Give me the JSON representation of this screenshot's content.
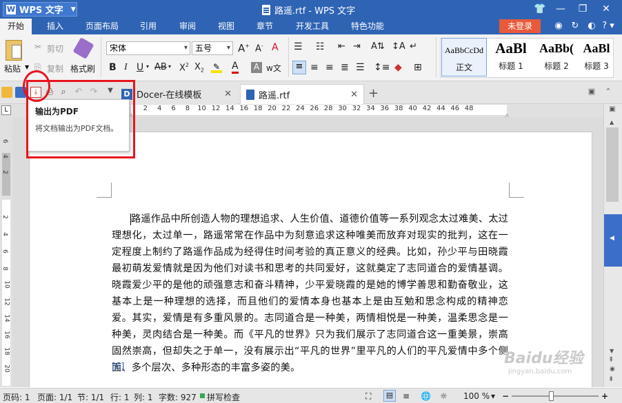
{
  "titlebar": {
    "app_button": "WPS 文字",
    "doc_title": "路遥.rtf - WPS 文字",
    "min": "—",
    "restore": "❐",
    "close": "✕"
  },
  "menu": {
    "tabs": [
      "开始",
      "插入",
      "页面布局",
      "引用",
      "审阅",
      "视图",
      "章节",
      "开发工具",
      "特色功能"
    ],
    "active": "开始",
    "login": "未登录"
  },
  "ribbon": {
    "paste": "粘贴",
    "cut": "剪切",
    "copy": "复制",
    "format_painter": "格式刷",
    "font_name": "宋体",
    "font_size": "五号",
    "styles": [
      {
        "preview": "AaBbCcDd",
        "label": "正文"
      },
      {
        "preview": "AaBl",
        "label": "标题 1"
      },
      {
        "preview": "AaBb(",
        "label": "标题 2"
      },
      {
        "preview": "AaBl",
        "label": "标题 3"
      }
    ]
  },
  "tabs": [
    {
      "label": "Docer-在线模板",
      "active": false
    },
    {
      "label": "路遥.rtf",
      "active": true
    }
  ],
  "tooltip": {
    "title": "输出为PDF",
    "desc": "将文档输出为PDF文档。"
  },
  "ruler": {
    "ticks": [
      "6",
      "4",
      "2",
      "",
      "2",
      "4",
      "6",
      "8",
      "10",
      "12",
      "14",
      "16",
      "18",
      "20",
      "22",
      "24",
      "26",
      "28",
      "30",
      "32",
      "34",
      "36",
      "38",
      "40",
      "42",
      "44",
      "46",
      "48"
    ]
  },
  "document": {
    "paragraph": "路遥作品中所创造人物的理想追求、人生价值、道德价值等一系列观念太过难美、太过理想化，太过单一，路遥常常在作品中为刻意追求这种唯美而放弃对现实的批判，这在一定程度上制约了路遥作品成为经得住时间考验的真正意义的经典。比如，孙少平与田晓霞最初萌发爱情就是因为他们对读书和思考的共同爱好，这就奠定了志同道合的爱情基调。晓霞爱少平的是他的顽强意志和奋斗精神，少平爱晓霞的是她的博学善思和勤奋敬业，这基本上是一种理想的选择，而且他们的爱情本身也基本上是由互勉和思念构成的精神恋爱。其实，爱情是有多重风景的。志同道合是一种美，两情相悦是一种美，温柔思念是一种美，灵肉结合是一种美。而《平凡的世界》只为我们展示了志同道合这一重美景，崇高固然崇高，但却失之于单一，没有展示出“平凡的世界”里平凡的人们的平凡爱情中多个侧面、多个层次、多种形态的丰富多姿的美。",
    "ref": "[6]"
  },
  "status": {
    "page": "页码: 1",
    "pages": "页面: 1/1",
    "section": "节: 1/1",
    "row": "行: 1",
    "col": "列: 1",
    "words": "字数: 927",
    "spell": "拼写检查",
    "zoom": "100 %"
  },
  "watermark": {
    "brand": "Baidu经验",
    "url": "jingyan.baidu.com"
  }
}
